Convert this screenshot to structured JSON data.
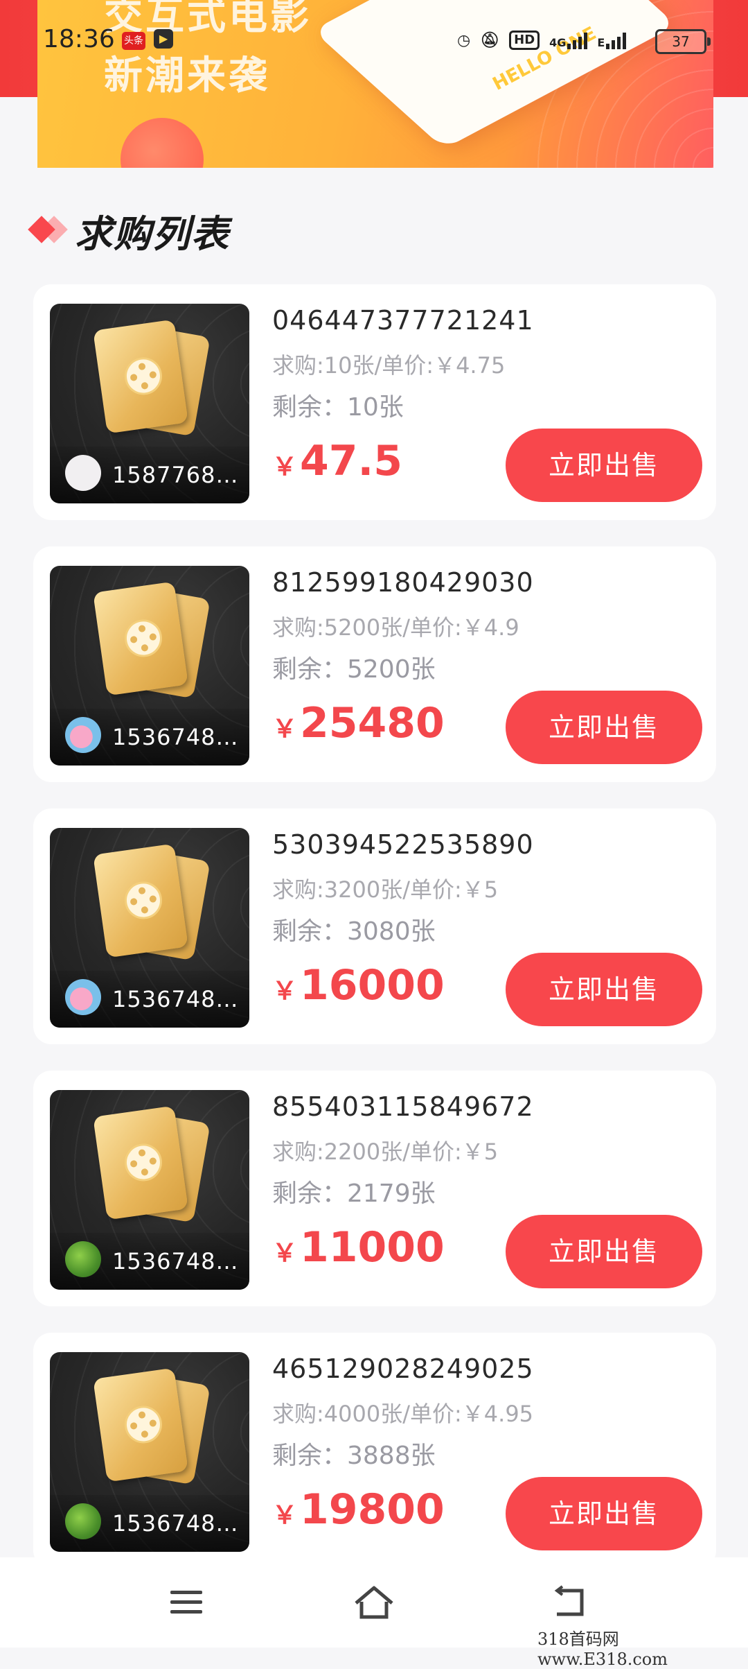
{
  "status_bar": {
    "time": "18:36",
    "badge_label": "头条",
    "net_label": "4G",
    "net_label2": "E",
    "hd_label": "HD",
    "battery": "37"
  },
  "banner": {
    "line1": "交互式电影",
    "line2": "新潮来袭",
    "card_text": "HELLO ONE"
  },
  "section": {
    "title": "求购列表",
    "accent_color": "#f9474d"
  },
  "orders": [
    {
      "order_no": "046447377721241",
      "detail": "求购:10张/单价:￥4.75",
      "remaining": "剩余：10张",
      "currency": "￥",
      "price": "47.5",
      "user": "1587768…",
      "avatar": "white",
      "button": "立即出售"
    },
    {
      "order_no": "812599180429030",
      "detail": "求购:5200张/单价:￥4.9",
      "remaining": "剩余：5200张",
      "currency": "￥",
      "price": "25480",
      "user": "1536748…",
      "avatar": "pig",
      "button": "立即出售"
    },
    {
      "order_no": "530394522535890",
      "detail": "求购:3200张/单价:￥5",
      "remaining": "剩余：3080张",
      "currency": "￥",
      "price": "16000",
      "user": "1536748…",
      "avatar": "pig",
      "button": "立即出售"
    },
    {
      "order_no": "855403115849672",
      "detail": "求购:2200张/单价:￥5",
      "remaining": "剩余：2179张",
      "currency": "￥",
      "price": "11000",
      "user": "1536748…",
      "avatar": "leaf",
      "button": "立即出售"
    },
    {
      "order_no": "465129028249025",
      "detail": "求购:4000张/单价:￥4.95",
      "remaining": "剩余：3888张",
      "currency": "￥",
      "price": "19800",
      "user": "1536748…",
      "avatar": "leaf",
      "button": "立即出售"
    }
  ],
  "nav": {
    "menu_icon": "menu-icon",
    "home_icon": "home-icon",
    "back_icon": "back-icon"
  },
  "watermark": "318首码网 www.E318.com"
}
